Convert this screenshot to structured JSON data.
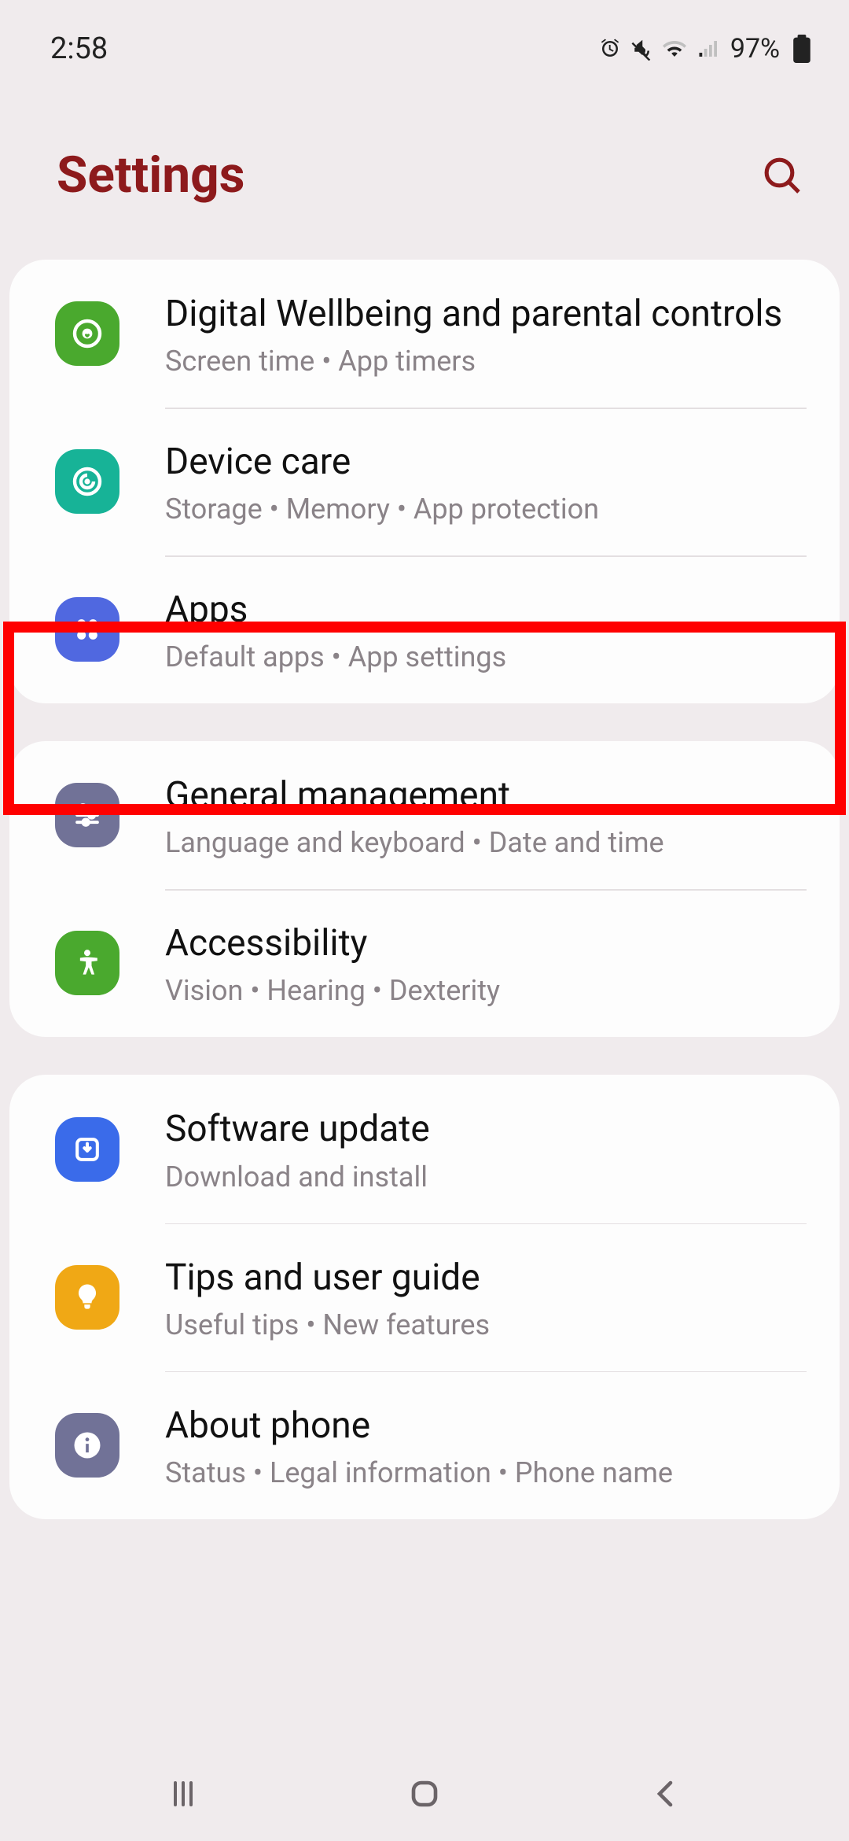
{
  "status_bar": {
    "time": "2:58",
    "battery_text": "97%"
  },
  "header": {
    "title": "Settings"
  },
  "sections": [
    {
      "items": [
        {
          "title": "Digital Wellbeing and parental controls",
          "sub": "Screen time  •  App timers",
          "icon": "wellbeing",
          "bg": "#4aa92e"
        },
        {
          "title": "Device care",
          "sub": "Storage  •  Memory  •  App protection",
          "icon": "devicecare",
          "bg": "#17b397"
        },
        {
          "title": "Apps",
          "sub": "Default apps  •  App settings",
          "icon": "apps",
          "bg": "#5068e0"
        }
      ]
    },
    {
      "items": [
        {
          "title": "General management",
          "sub": "Language and keyboard  •  Date and time",
          "icon": "sliders",
          "bg": "#717297"
        },
        {
          "title": "Accessibility",
          "sub": "Vision  •  Hearing  •  Dexterity",
          "icon": "accessibility",
          "bg": "#4aa92e"
        }
      ]
    },
    {
      "items": [
        {
          "title": "Software update",
          "sub": "Download and install",
          "icon": "update",
          "bg": "#3a6bea"
        },
        {
          "title": "Tips and user guide",
          "sub": "Useful tips  •  New features",
          "icon": "bulb",
          "bg": "#f0a815"
        },
        {
          "title": "About phone",
          "sub": "Status  •  Legal information  •  Phone name",
          "icon": "info",
          "bg": "#717297"
        }
      ]
    }
  ],
  "colors": {
    "header": "#8d1a1c"
  }
}
